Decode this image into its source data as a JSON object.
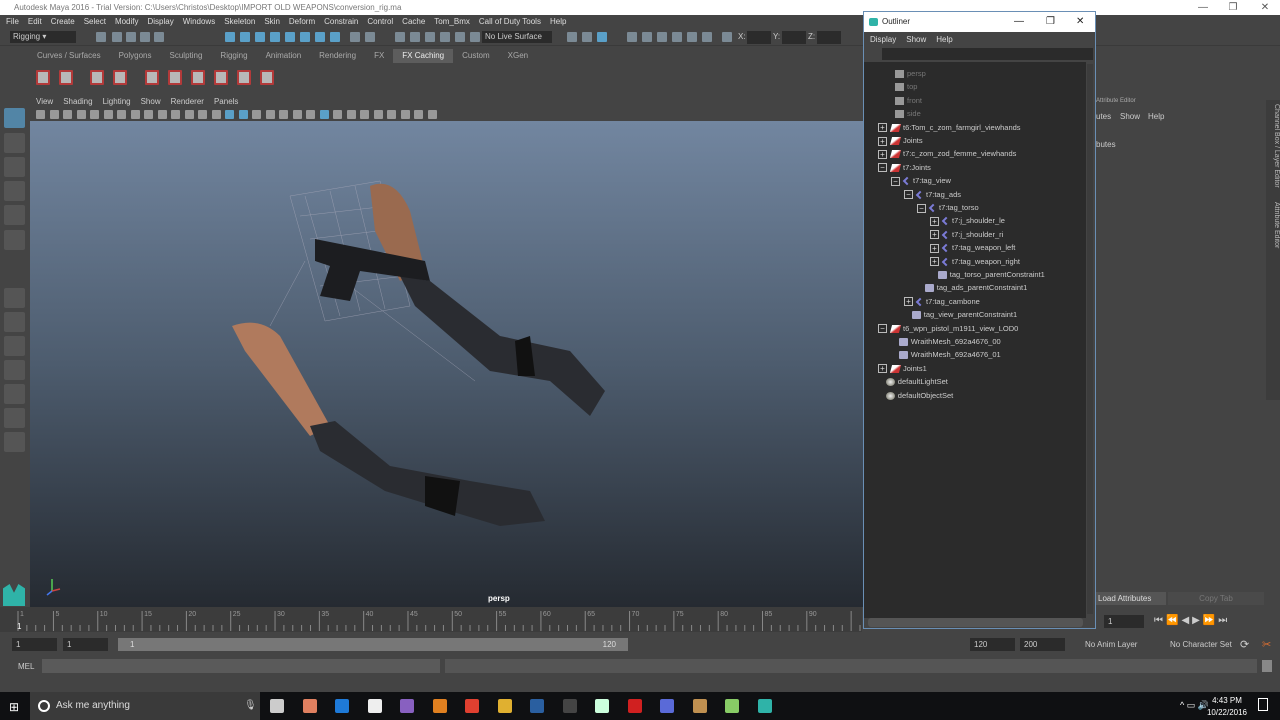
{
  "window": {
    "title": "Autodesk Maya 2016 - Trial Version: C:\\Users\\Christos\\Desktop\\IMPORT OLD WEAPONS\\conversion_rig.ma",
    "minimize": "—",
    "maximize": "❐",
    "close": "✕"
  },
  "menu": [
    "File",
    "Edit",
    "Create",
    "Select",
    "Modify",
    "Display",
    "Windows",
    "Skeleton",
    "Skin",
    "Deform",
    "Constrain",
    "Control",
    "Cache",
    "Tom_Bmx",
    "Call of Duty Tools",
    "Help"
  ],
  "toolbar": {
    "mode": "Rigging",
    "live_surface": "No Live Surface",
    "x_label": "X:",
    "y_label": "Y:",
    "z_label": "Z:"
  },
  "shelf_tabs": [
    "Curves / Surfaces",
    "Polygons",
    "Sculpting",
    "Rigging",
    "Animation",
    "Rendering",
    "FX",
    "FX Caching",
    "Custom",
    "XGen"
  ],
  "shelf_active": "FX Caching",
  "panel_menu": [
    "View",
    "Shading",
    "Lighting",
    "Show",
    "Renderer",
    "Panels"
  ],
  "viewport": {
    "camera": "persp"
  },
  "timeline": {
    "ticks": [
      "1",
      "5",
      "10",
      "15",
      "20",
      "25",
      "30",
      "35",
      "40",
      "45",
      "50",
      "55",
      "60",
      "65",
      "70",
      "75",
      "80",
      "85",
      "90"
    ],
    "current_frame": "1"
  },
  "range": {
    "start": "1",
    "playback_start": "1",
    "slider_start": "1",
    "slider_end": "120",
    "playback_end": "120",
    "end": "200",
    "anim_layer": "No Anim Layer",
    "character_set": "No Character Set"
  },
  "mel": {
    "label": "MEL"
  },
  "outliner": {
    "title": "Outliner",
    "menu": [
      "Display",
      "Show",
      "Help"
    ],
    "items": [
      {
        "label": "persp",
        "icon": "cam",
        "depth": 0,
        "dim": true
      },
      {
        "label": "top",
        "icon": "cam",
        "depth": 0,
        "dim": true
      },
      {
        "label": "front",
        "icon": "cam",
        "depth": 0,
        "dim": true
      },
      {
        "label": "side",
        "icon": "cam",
        "depth": 0,
        "dim": true
      },
      {
        "label": "t6:Tom_c_zom_farmgirl_viewhands",
        "icon": "tr",
        "depth": 0,
        "exp": "+"
      },
      {
        "label": "Joints",
        "icon": "tr",
        "depth": 0,
        "exp": "+"
      },
      {
        "label": "t7:c_zom_zod_femme_viewhands",
        "icon": "tr",
        "depth": 0,
        "exp": "+"
      },
      {
        "label": "t7:Joints",
        "icon": "tr",
        "depth": 0,
        "exp": "−"
      },
      {
        "label": "t7:tag_view",
        "icon": "jt",
        "depth": 1,
        "exp": "−"
      },
      {
        "label": "t7:tag_ads",
        "icon": "jt",
        "depth": 2,
        "exp": "−"
      },
      {
        "label": "t7:tag_torso",
        "icon": "jt",
        "depth": 3,
        "exp": "−"
      },
      {
        "label": "t7:j_shoulder_le",
        "icon": "jt",
        "depth": 4,
        "exp": "+"
      },
      {
        "label": "t7:j_shoulder_ri",
        "icon": "jt",
        "depth": 4,
        "exp": "+"
      },
      {
        "label": "t7:tag_weapon_left",
        "icon": "jt",
        "depth": 4,
        "exp": "+"
      },
      {
        "label": "t7:tag_weapon_right",
        "icon": "jt",
        "depth": 4,
        "exp": "+"
      },
      {
        "label": "tag_torso_parentConstraint1",
        "icon": "cn",
        "depth": 4.6
      },
      {
        "label": "tag_ads_parentConstraint1",
        "icon": "cn",
        "depth": 3.6
      },
      {
        "label": "t7:tag_cambone",
        "icon": "jt",
        "depth": 2,
        "exp": "+"
      },
      {
        "label": "tag_view_parentConstraint1",
        "icon": "cn",
        "depth": 2.6
      },
      {
        "label": "t6_wpn_pistol_m1911_view_LOD0",
        "icon": "tr",
        "depth": 0,
        "exp": "−"
      },
      {
        "label": "WraithMesh_692a4676_00",
        "icon": "cn",
        "depth": 1.6
      },
      {
        "label": "WraithMesh_692a4676_01",
        "icon": "cn",
        "depth": 1.6
      },
      {
        "label": "Joints1",
        "icon": "tr",
        "depth": 0,
        "exp": "+"
      },
      {
        "label": "defaultLightSet",
        "icon": "set",
        "depth": 0.6
      },
      {
        "label": "defaultObjectSet",
        "icon": "set",
        "depth": 0.6
      }
    ]
  },
  "attribute_editor": {
    "title": "Attribute Editor",
    "menu_partial": "utes",
    "show": "Show",
    "help": "Help",
    "section_partial": "butes",
    "load_attributes": "Load Attributes",
    "copy_tab": "Copy Tab",
    "side_tab": "Channel Box / Layer Editor",
    "side_tab2": "Attribute Editor",
    "frame_field": "1"
  },
  "taskbar": {
    "search_placeholder": "Ask me anything",
    "time": "4:43 PM",
    "date": "10/22/2016"
  }
}
